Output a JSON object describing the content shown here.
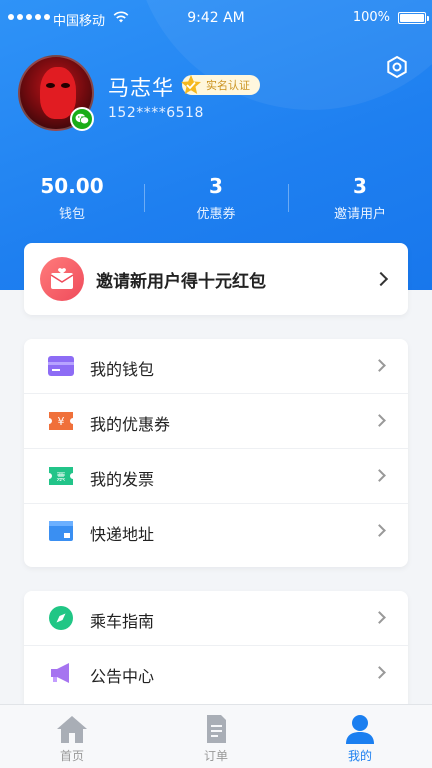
{
  "status_bar": {
    "carrier": "中国移动",
    "time": "9:42 AM",
    "battery": "100%"
  },
  "profile": {
    "name": "马志华",
    "verified_label": "实名认证",
    "phone": "152****6518"
  },
  "stats": [
    {
      "value": "50.00",
      "label": "钱包"
    },
    {
      "value": "3",
      "label": "优惠券"
    },
    {
      "value": "3",
      "label": "邀请用户"
    }
  ],
  "invite_banner": {
    "label": "邀请新用户得十元红包"
  },
  "menu_group_1": [
    {
      "label": "我的钱包",
      "icon": "wallet-icon"
    },
    {
      "label": "我的优惠券",
      "icon": "coupon-icon"
    },
    {
      "label": "我的发票",
      "icon": "invoice-icon"
    },
    {
      "label": "快递地址",
      "icon": "address-icon"
    }
  ],
  "menu_group_2": [
    {
      "label": "乘车指南",
      "icon": "compass-icon"
    },
    {
      "label": "公告中心",
      "icon": "megaphone-icon"
    }
  ],
  "coupon_glyph": "¥",
  "invoice_glyph": "票",
  "tabs": [
    {
      "label": "首页",
      "icon": "home-icon"
    },
    {
      "label": "订单",
      "icon": "order-icon"
    },
    {
      "label": "我的",
      "icon": "user-icon",
      "active": true
    }
  ],
  "colors": {
    "primary": "#1e7ff0",
    "verified_text": "#c9901b",
    "active_tab": "#1b7ff0"
  }
}
